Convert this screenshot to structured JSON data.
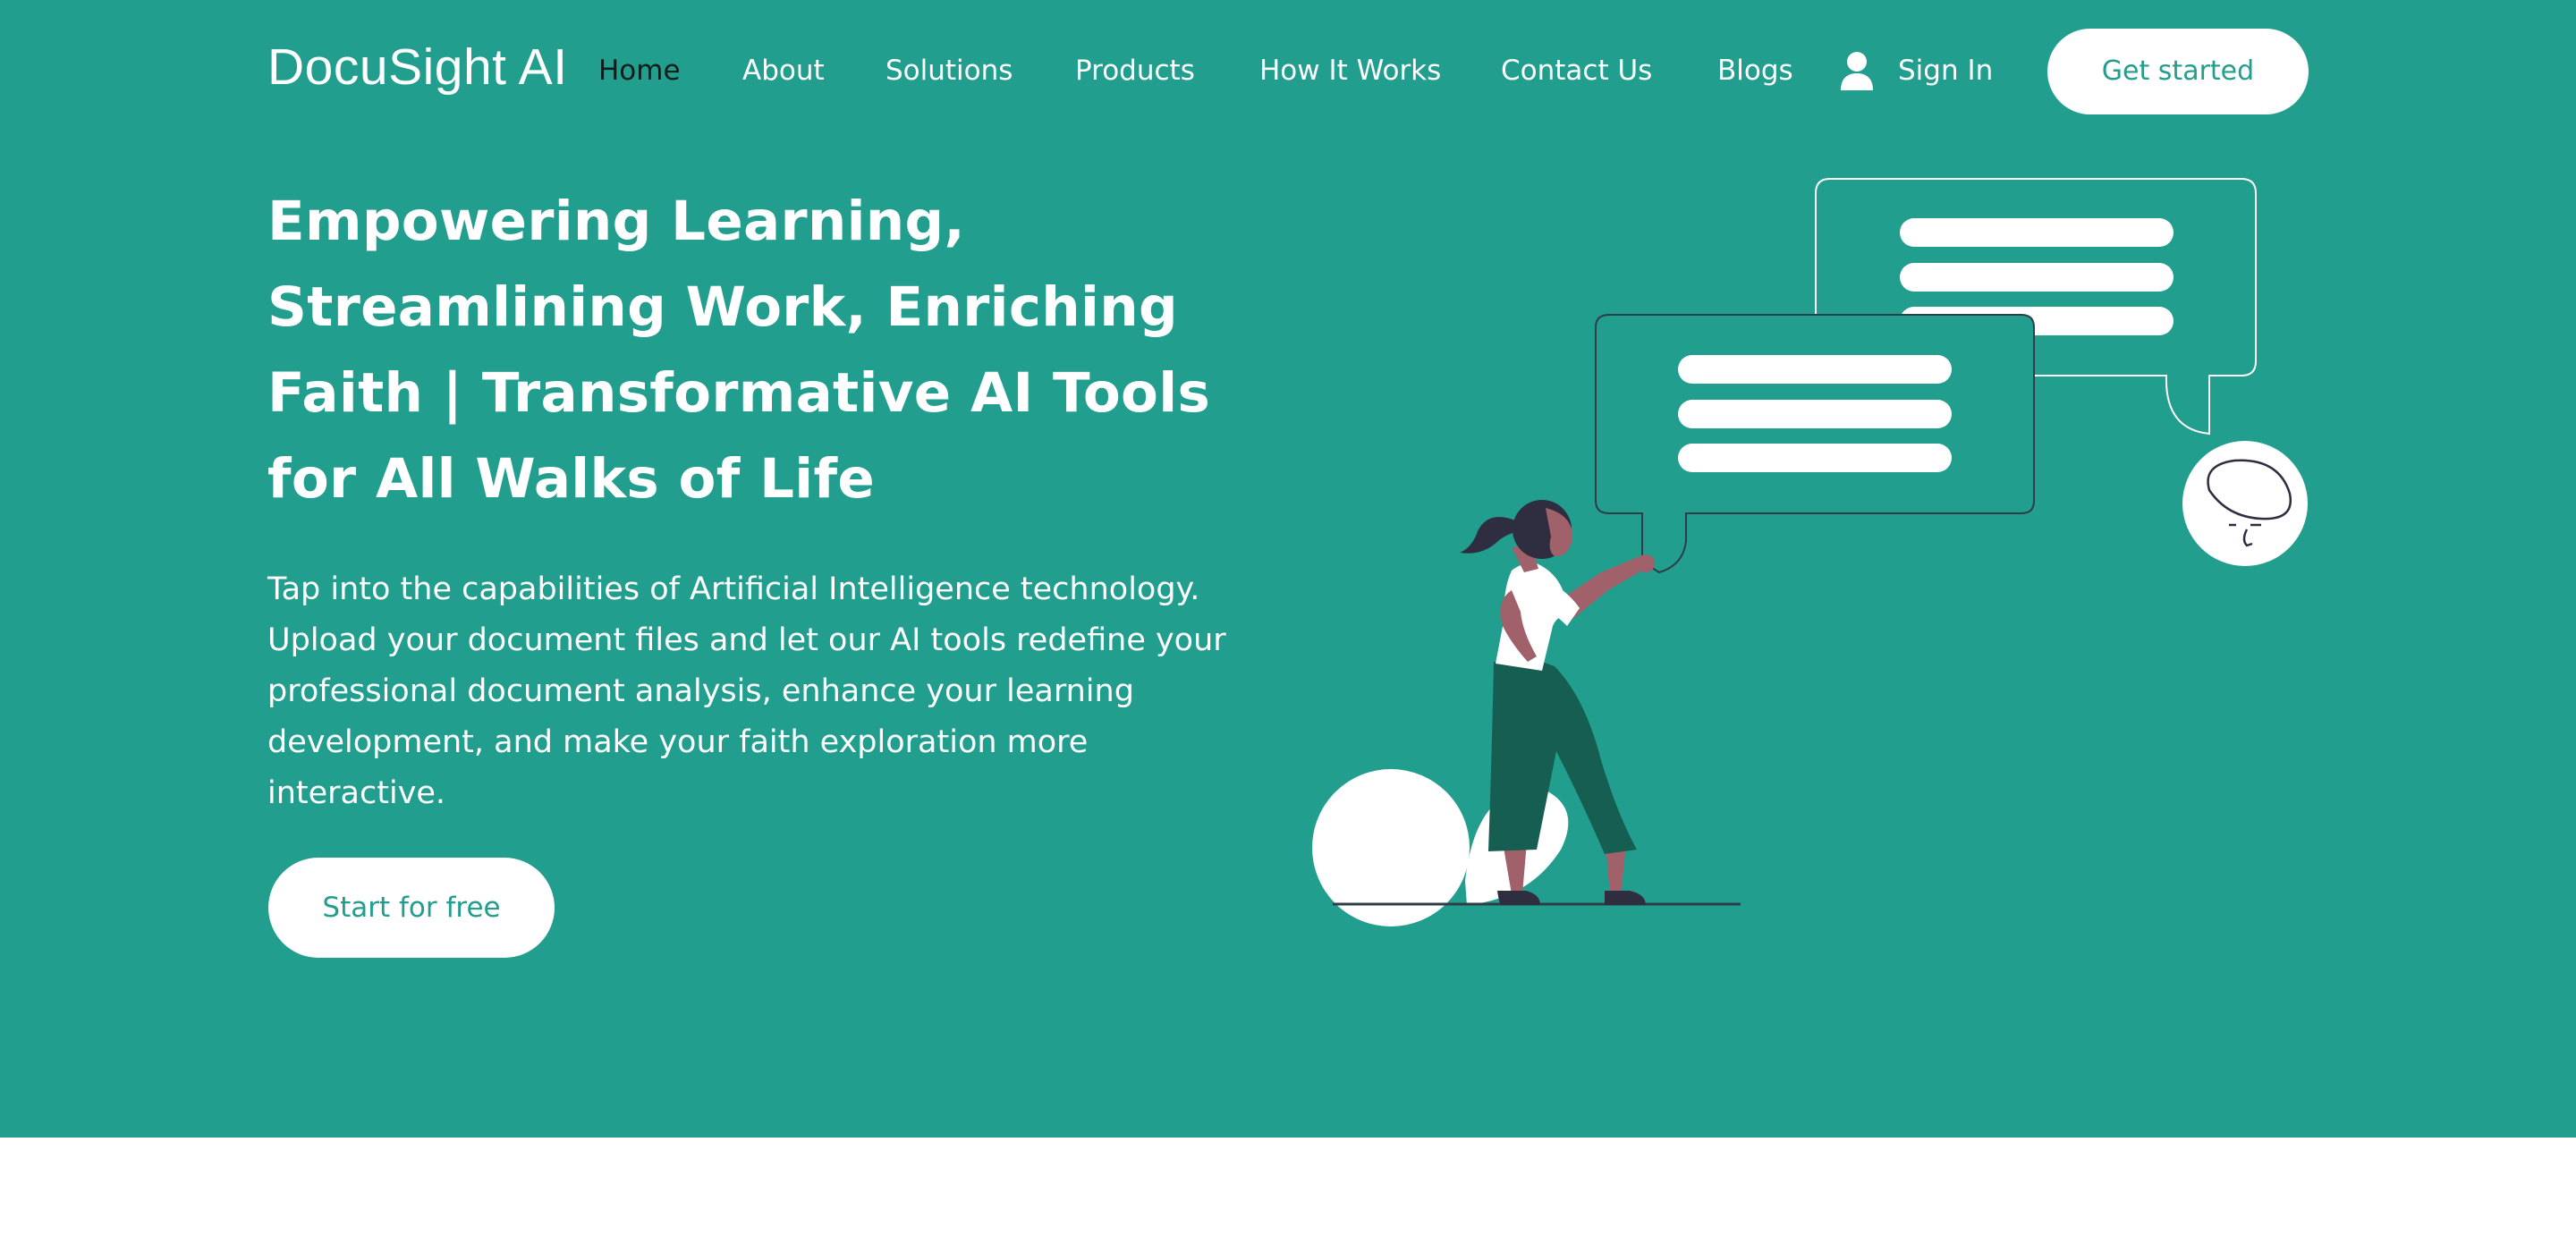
{
  "brand": {
    "logo_text": "DocuSight AI"
  },
  "nav": {
    "items": [
      {
        "label": "Home",
        "active": true
      },
      {
        "label": "About",
        "active": false
      },
      {
        "label": "Solutions",
        "active": false
      },
      {
        "label": "Products",
        "active": false
      },
      {
        "label": "How It Works",
        "active": false
      },
      {
        "label": "Contact Us",
        "active": false
      },
      {
        "label": "Blogs",
        "active": false
      }
    ],
    "sign_in_label": "Sign In",
    "sign_in_icon": "user-icon",
    "cta_label": "Get started"
  },
  "hero": {
    "headline_lines": [
      "Empowering Learning,",
      "Streamlining Work, Enriching",
      "Faith | Transformative AI Tools",
      "for All Walks of Life"
    ],
    "description_lines": [
      "Tap into the capabilities of Artificial Intelligence technology.",
      "Upload your document files and let our AI tools redefine your",
      "professional document analysis, enhance your learning",
      "development, and make your faith exploration more",
      "interactive."
    ],
    "cta_label": "Start for free"
  },
  "colors": {
    "hero_background": "#219e8e",
    "white": "#ffffff",
    "active_nav_text": "#0f1e1c",
    "figure_pants": "#175e52",
    "figure_skin": "#a0616a",
    "figure_hair": "#2f2e41"
  }
}
